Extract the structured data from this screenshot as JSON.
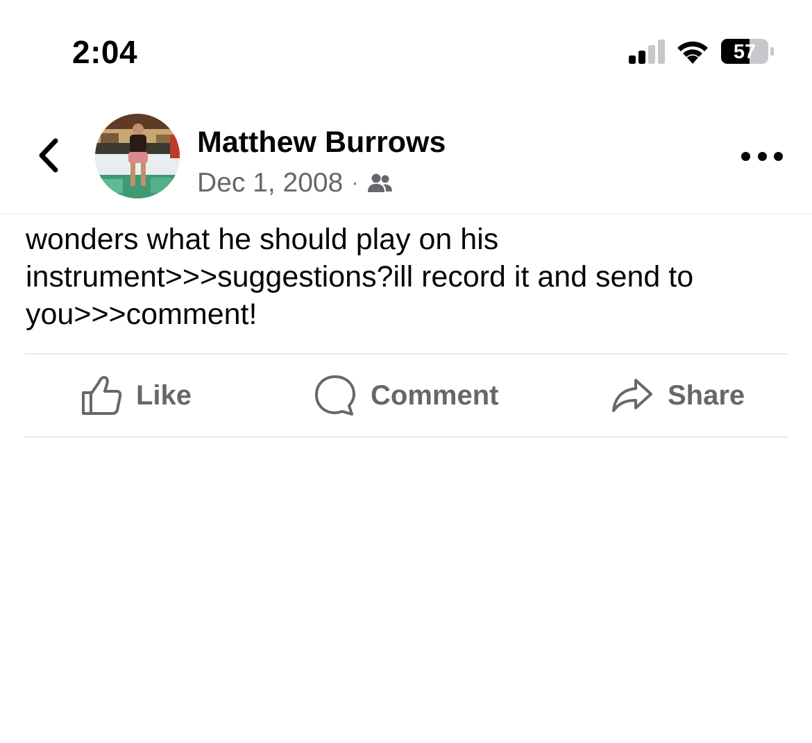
{
  "status_bar": {
    "time": "2:04",
    "battery_level": "57",
    "icons": [
      "cellular-signal-icon",
      "wifi-icon",
      "battery-icon"
    ]
  },
  "post": {
    "author": "Matthew Burrows",
    "date": "Dec 1, 2008",
    "separator": "·",
    "audience_icon": "friends-icon",
    "text": "wonders what he should play on his\ninstrument>>>suggestions?ill record it and send to\nyou>>>comment!"
  },
  "actions": {
    "like": "Like",
    "comment": "Comment",
    "share": "Share"
  },
  "colors": {
    "primary_text": "#050505",
    "secondary_text": "#65676b",
    "divider": "#e4e6eb"
  }
}
